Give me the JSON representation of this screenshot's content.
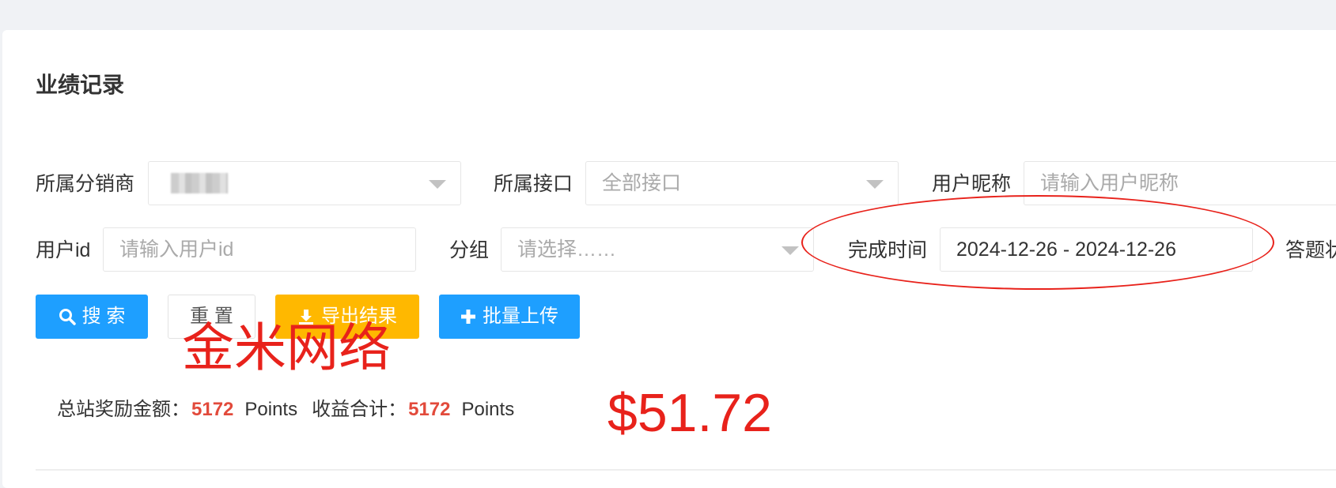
{
  "page": {
    "title": "业绩记录"
  },
  "filters": {
    "distributor_label": "所属分销商",
    "interface_label": "所属接口",
    "interface_value": "全部接口",
    "nickname_label": "用户昵称",
    "nickname_placeholder": "请输入用户昵称",
    "userid_label": "用户id",
    "userid_placeholder": "请输入用户id",
    "group_label": "分组",
    "group_placeholder": "请选择……",
    "completion_time_label": "完成时间",
    "completion_time_value": "2024-12-26 - 2024-12-26",
    "answer_status_label": "答题状"
  },
  "buttons": {
    "search": "搜 索",
    "reset": "重 置",
    "export": "导出结果",
    "batch_upload": "批量上传"
  },
  "stats": {
    "station_reward_label": "总站奖励金额：",
    "station_reward_value": "5172",
    "unit": "Points",
    "income_total_label": "收益合计：",
    "income_total_value": "5172"
  },
  "overlay": {
    "watermark": "金米网络",
    "amount": "$51.72"
  },
  "colors": {
    "primary": "#1e9fff",
    "warning": "#ffb800",
    "highlight_number": "#e24a3b",
    "annotation_red": "#e8221b"
  }
}
